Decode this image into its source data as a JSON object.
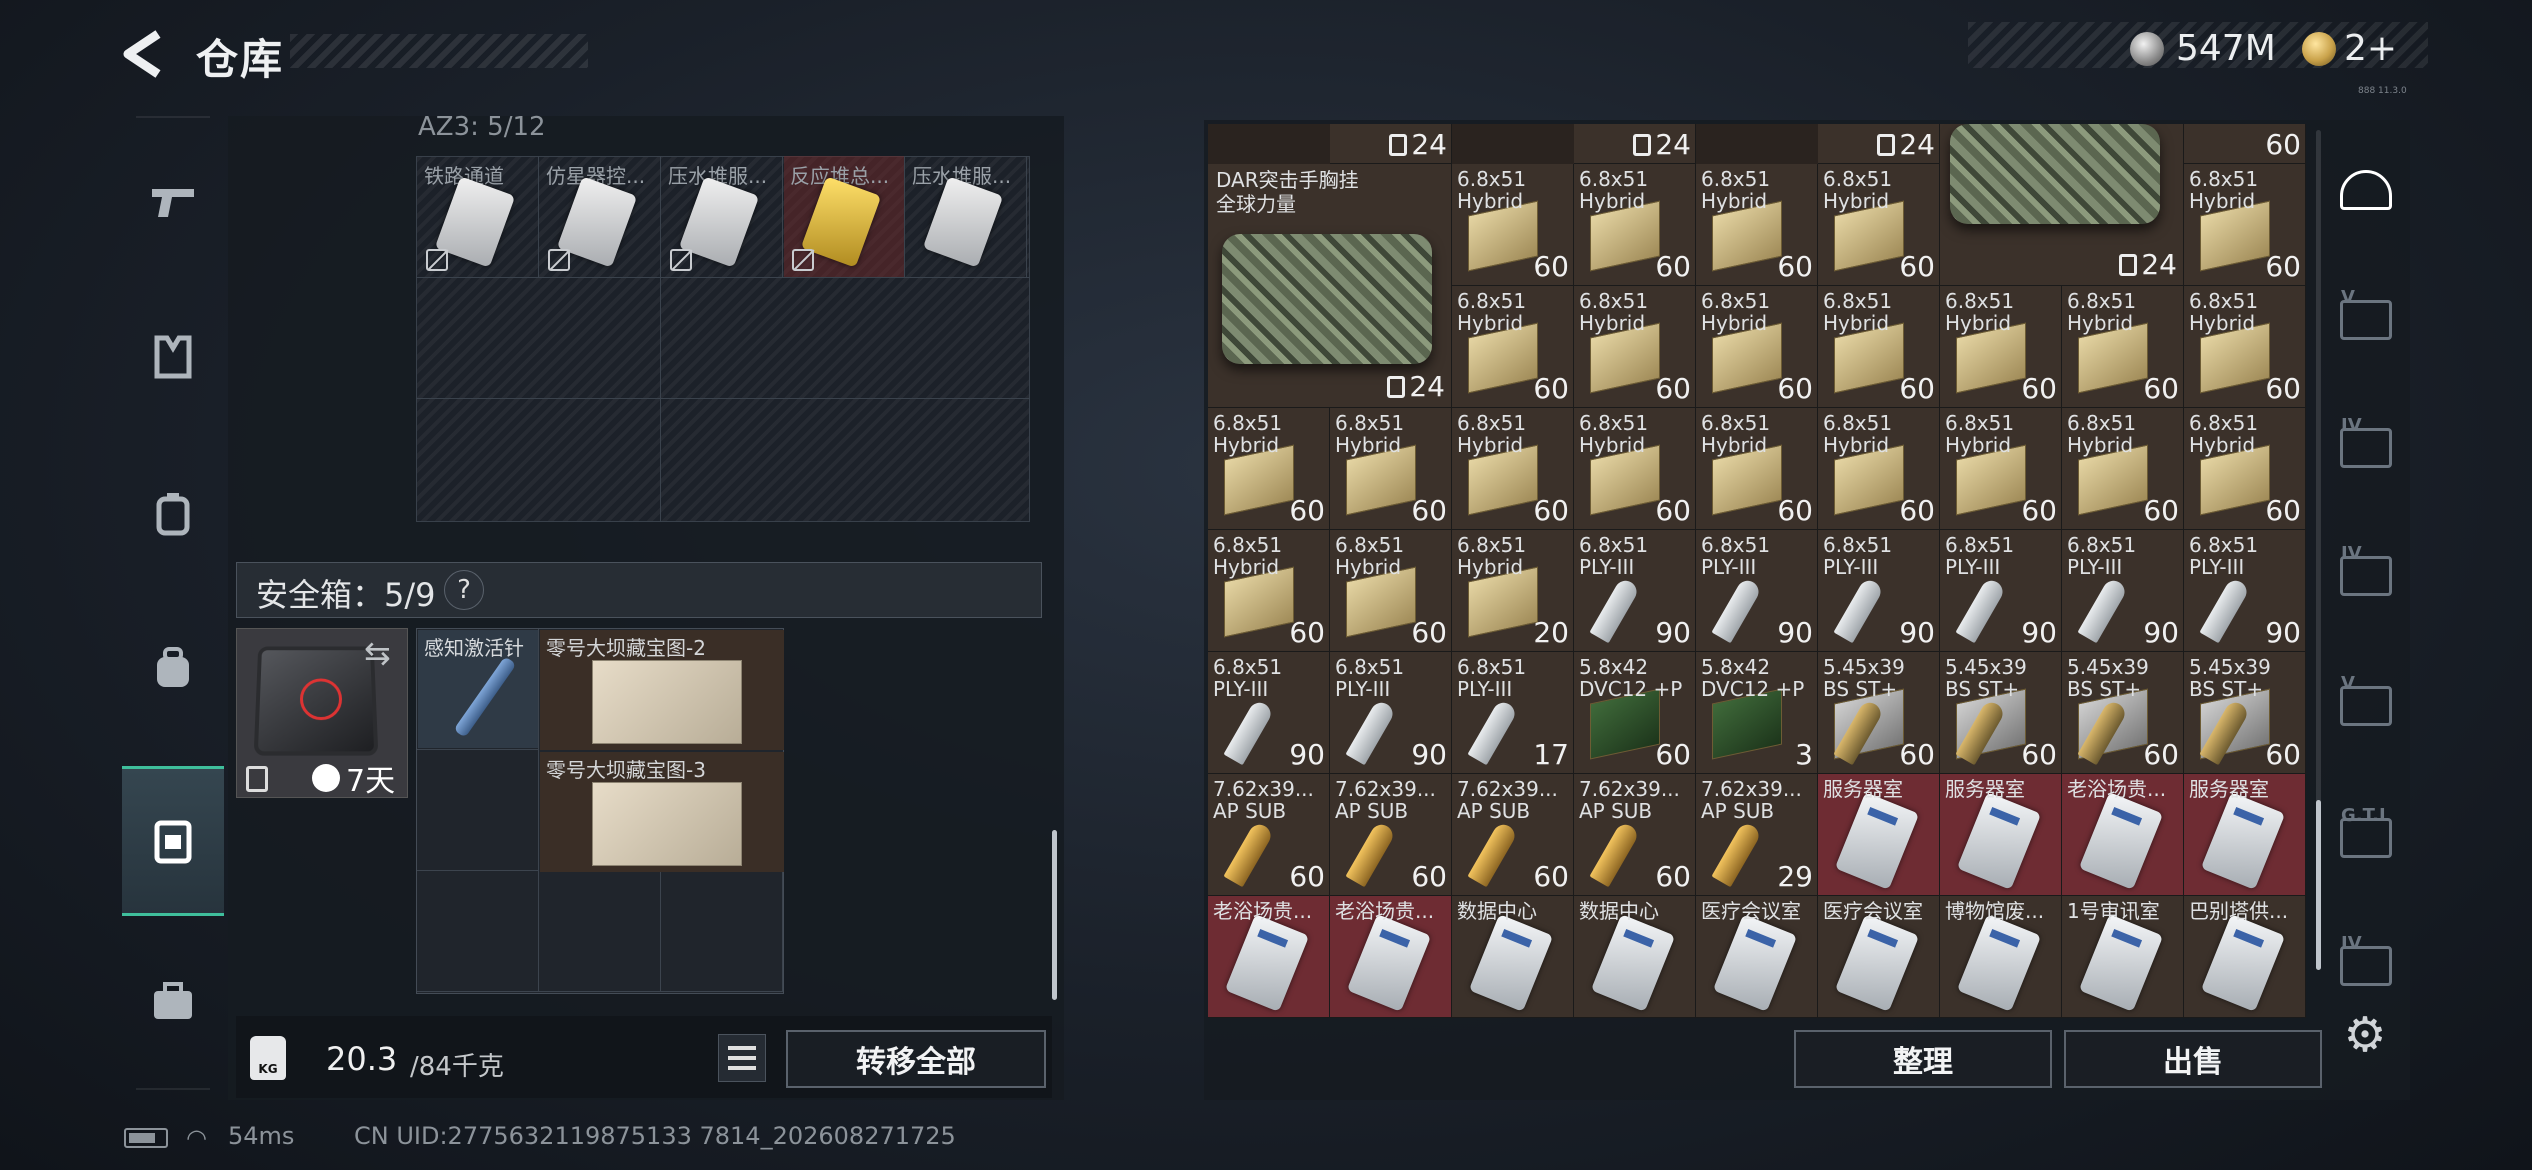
{
  "header": {
    "title": "仓库",
    "money": "547M",
    "tickets": "2+",
    "tiny_text": "888 11.3.0"
  },
  "left_nav": {
    "items": [
      {
        "name": "gun-icon",
        "active": false
      },
      {
        "name": "armor-icon",
        "active": false
      },
      {
        "name": "vest-icon",
        "active": false
      },
      {
        "name": "backpack-icon",
        "active": false
      },
      {
        "name": "safebox-icon",
        "active": true
      },
      {
        "name": "briefcase-icon",
        "active": false
      }
    ]
  },
  "az3": {
    "label": "AZ3: 5/12",
    "items": [
      {
        "name": "铁路通道",
        "red": false
      },
      {
        "name": "仿星器控...",
        "red": false
      },
      {
        "name": "压水堆服...",
        "red": false
      },
      {
        "name": "反应堆总...",
        "red": true
      },
      {
        "name": "压水堆服...",
        "red": false
      }
    ]
  },
  "safebox": {
    "label": "安全箱：5/9",
    "help": "?",
    "days": "7天",
    "items": [
      {
        "name": "感知激活针"
      },
      {
        "name": "零号大坝藏宝图-2"
      },
      {
        "name": "零号大坝藏宝图-3"
      }
    ]
  },
  "weight": {
    "icon_label": "KG",
    "current": "20.3",
    "max": "/84千克"
  },
  "buttons": {
    "transfer_all": "转移全部",
    "sort": "整理",
    "sell": "出售"
  },
  "status": {
    "ping": "54ms",
    "uid": "CN UID:2775632119875133 7814_202608271725"
  },
  "inventory": {
    "top_row_counts": [
      "24",
      "24",
      "24",
      "60"
    ],
    "rig": {
      "name": "DAR突击手胸挂\n全球力量",
      "count": "24"
    },
    "rig2_count": "24",
    "rows": [
      [
        null,
        null,
        {
          "n": "6.8x51\nHybrid",
          "c": "60",
          "t": "ammo"
        },
        {
          "n": "6.8x51\nHybrid",
          "c": "60",
          "t": "ammo"
        },
        {
          "n": "6.8x51\nHybrid",
          "c": "60",
          "t": "ammo"
        },
        {
          "n": "6.8x51\nHybrid",
          "c": "60",
          "t": "ammo"
        },
        null,
        null,
        {
          "n": "6.8x51\nHybrid",
          "c": "60",
          "t": "ammo"
        }
      ],
      [
        null,
        null,
        {
          "n": "6.8x51\nHybrid",
          "c": "60",
          "t": "ammo"
        },
        {
          "n": "6.8x51\nHybrid",
          "c": "60",
          "t": "ammo"
        },
        {
          "n": "6.8x51\nHybrid",
          "c": "60",
          "t": "ammo"
        },
        {
          "n": "6.8x51\nHybrid",
          "c": "60",
          "t": "ammo"
        },
        {
          "n": "6.8x51\nHybrid",
          "c": "60",
          "t": "ammo"
        },
        {
          "n": "6.8x51\nHybrid",
          "c": "60",
          "t": "ammo"
        },
        {
          "n": "6.8x51\nHybrid",
          "c": "60",
          "t": "ammo"
        }
      ],
      [
        {
          "n": "6.8x51\nHybrid",
          "c": "60",
          "t": "ammo"
        },
        {
          "n": "6.8x51\nHybrid",
          "c": "60",
          "t": "ammo"
        },
        {
          "n": "6.8x51\nHybrid",
          "c": "60",
          "t": "ammo"
        },
        {
          "n": "6.8x51\nHybrid",
          "c": "60",
          "t": "ammo"
        },
        {
          "n": "6.8x51\nHybrid",
          "c": "60",
          "t": "ammo"
        },
        {
          "n": "6.8x51\nHybrid",
          "c": "60",
          "t": "ammo"
        },
        {
          "n": "6.8x51\nHybrid",
          "c": "60",
          "t": "ammo"
        },
        {
          "n": "6.8x51\nHybrid",
          "c": "60",
          "t": "ammo"
        },
        {
          "n": "6.8x51\nHybrid",
          "c": "60",
          "t": "ammo"
        }
      ],
      [
        {
          "n": "6.8x51\nHybrid",
          "c": "60",
          "t": "ammo"
        },
        {
          "n": "6.8x51\nHybrid",
          "c": "60",
          "t": "ammo"
        },
        {
          "n": "6.8x51\nHybrid",
          "c": "20",
          "t": "ammo"
        },
        {
          "n": "6.8x51\nPLY-III",
          "c": "90",
          "t": "bullet"
        },
        {
          "n": "6.8x51\nPLY-III",
          "c": "90",
          "t": "bullet"
        },
        {
          "n": "6.8x51\nPLY-III",
          "c": "90",
          "t": "bullet"
        },
        {
          "n": "6.8x51\nPLY-III",
          "c": "90",
          "t": "bullet"
        },
        {
          "n": "6.8x51\nPLY-III",
          "c": "90",
          "t": "bullet"
        },
        {
          "n": "6.8x51\nPLY-III",
          "c": "90",
          "t": "bullet"
        }
      ],
      [
        {
          "n": "6.8x51\nPLY-III",
          "c": "90",
          "t": "bullet"
        },
        {
          "n": "6.8x51\nPLY-III",
          "c": "90",
          "t": "bullet"
        },
        {
          "n": "6.8x51\nPLY-III",
          "c": "17",
          "t": "bullet"
        },
        {
          "n": "5.8x42\nDVC12 +P",
          "c": "60",
          "t": "green"
        },
        {
          "n": "5.8x42\nDVC12 +P",
          "c": "3",
          "t": "green"
        },
        {
          "n": "5.45x39\nBS ST+",
          "c": "60",
          "t": "steel"
        },
        {
          "n": "5.45x39\nBS ST+",
          "c": "60",
          "t": "steel"
        },
        {
          "n": "5.45x39\nBS ST+",
          "c": "60",
          "t": "steel"
        },
        {
          "n": "5.45x39\nBS ST+",
          "c": "60",
          "t": "steel"
        }
      ],
      [
        {
          "n": "7.62x39...\nAP SUB",
          "c": "60",
          "t": "gold"
        },
        {
          "n": "7.62x39...\nAP SUB",
          "c": "60",
          "t": "gold"
        },
        {
          "n": "7.62x39...\nAP SUB",
          "c": "60",
          "t": "gold"
        },
        {
          "n": "7.62x39...\nAP SUB",
          "c": "60",
          "t": "gold"
        },
        {
          "n": "7.62x39...\nAP SUB",
          "c": "29",
          "t": "gold"
        },
        {
          "n": "服务器室",
          "c": "",
          "t": "card"
        },
        {
          "n": "服务器室",
          "c": "",
          "t": "card"
        },
        {
          "n": "老浴场贵...",
          "c": "",
          "t": "card"
        },
        {
          "n": "服务器室",
          "c": "",
          "t": "card"
        }
      ],
      [
        {
          "n": "老浴场贵...",
          "c": "",
          "t": "card"
        },
        {
          "n": "老浴场贵...",
          "c": "",
          "t": "card"
        },
        {
          "n": "数据中心",
          "c": "",
          "t": "card-gray"
        },
        {
          "n": "数据中心",
          "c": "",
          "t": "card-gray"
        },
        {
          "n": "医疗会议室",
          "c": "",
          "t": "card-gray"
        },
        {
          "n": "医疗会议室",
          "c": "",
          "t": "card-gray"
        },
        {
          "n": "博物馆废...",
          "c": "",
          "t": "card-gray"
        },
        {
          "n": "1号审讯室",
          "c": "",
          "t": "card-gray"
        },
        {
          "n": "巴别塔供...",
          "c": "",
          "t": "card-gray"
        }
      ]
    ]
  },
  "right_nav": {
    "tags": [
      "",
      "V",
      "IV",
      "IV",
      "V",
      "G.T.I",
      "IV"
    ]
  }
}
